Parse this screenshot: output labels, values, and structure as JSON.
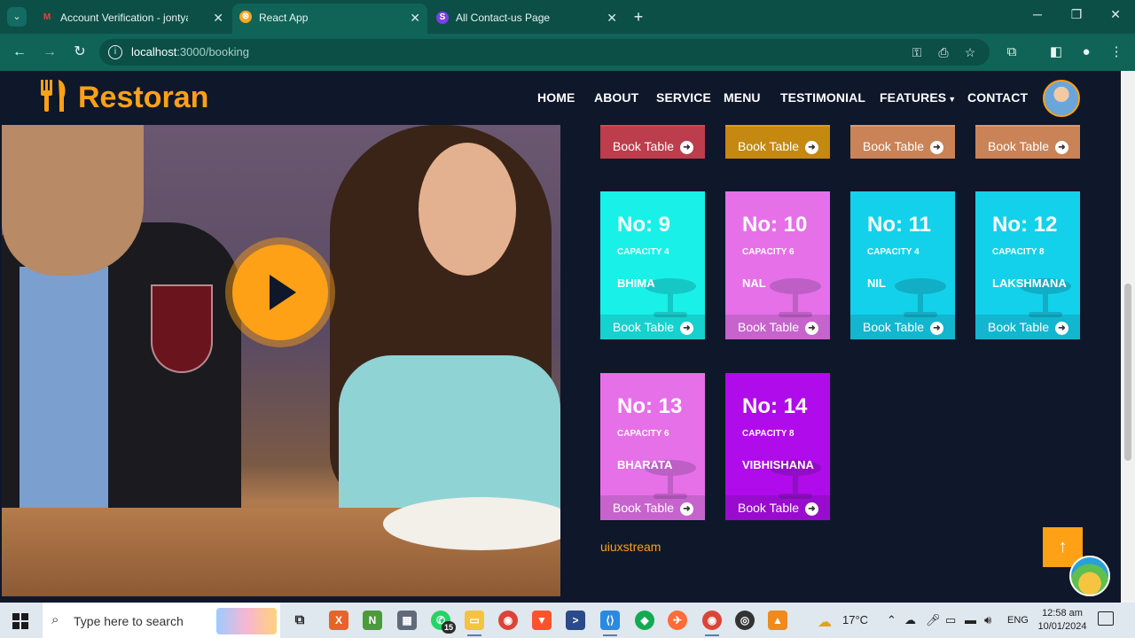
{
  "browser": {
    "tabs": [
      {
        "label": "Account Verification - jontyabir",
        "favicon": "gmail-icon",
        "favicon_text": "M",
        "favicon_color": "#ea4335",
        "active": false
      },
      {
        "label": "React App",
        "favicon": "react-app-icon",
        "favicon_text": "⊗",
        "favicon_color": "#f5a623",
        "active": true
      },
      {
        "label": "All Contact-us Page",
        "favicon": "app-s-icon",
        "favicon_text": "S",
        "favicon_color": "#7b3fe4",
        "active": false
      }
    ],
    "url_host": "localhost",
    "url_path": ":3000/booking"
  },
  "site": {
    "brand": "Restoran",
    "nav": [
      "HOME",
      "ABOUT",
      "SERVICE",
      "MENU",
      "TESTIMONIAL",
      "FEATURES",
      "CONTACT"
    ],
    "accent_color": "#fea116",
    "bg_color": "#0f172b",
    "book_label": "Book Table",
    "partial_cards": [
      {
        "color": "#d94452"
      },
      {
        "color": "#e39b0c"
      },
      {
        "color": "#e8955e"
      },
      {
        "color": "#e8955e"
      }
    ],
    "tables": [
      {
        "no": "No: 9",
        "capacity": "CAPACITY 4",
        "name": "BHIMA",
        "color": "#18f0e8"
      },
      {
        "no": "No: 10",
        "capacity": "CAPACITY 6",
        "name": "NAL",
        "color": "#e670e8"
      },
      {
        "no": "No: 11",
        "capacity": "CAPACITY 4",
        "name": "NIL",
        "color": "#13d1ea"
      },
      {
        "no": "No: 12",
        "capacity": "CAPACITY 8",
        "name": "LAKSHMANA",
        "color": "#13d1ea"
      },
      {
        "no": "No: 13",
        "capacity": "CAPACITY 6",
        "name": "BHARATA",
        "color": "#e670e8"
      },
      {
        "no": "No: 14",
        "capacity": "CAPACITY 8",
        "name": "VIBHISHANA",
        "color": "#b00bea"
      }
    ],
    "footer_text": "uiuxstream"
  },
  "taskbar": {
    "search_placeholder": "Type here to search",
    "whatsapp_badge": "15",
    "weather": "17°C",
    "lang": "ENG",
    "time": "12:58 am",
    "date": "10/01/2024"
  }
}
